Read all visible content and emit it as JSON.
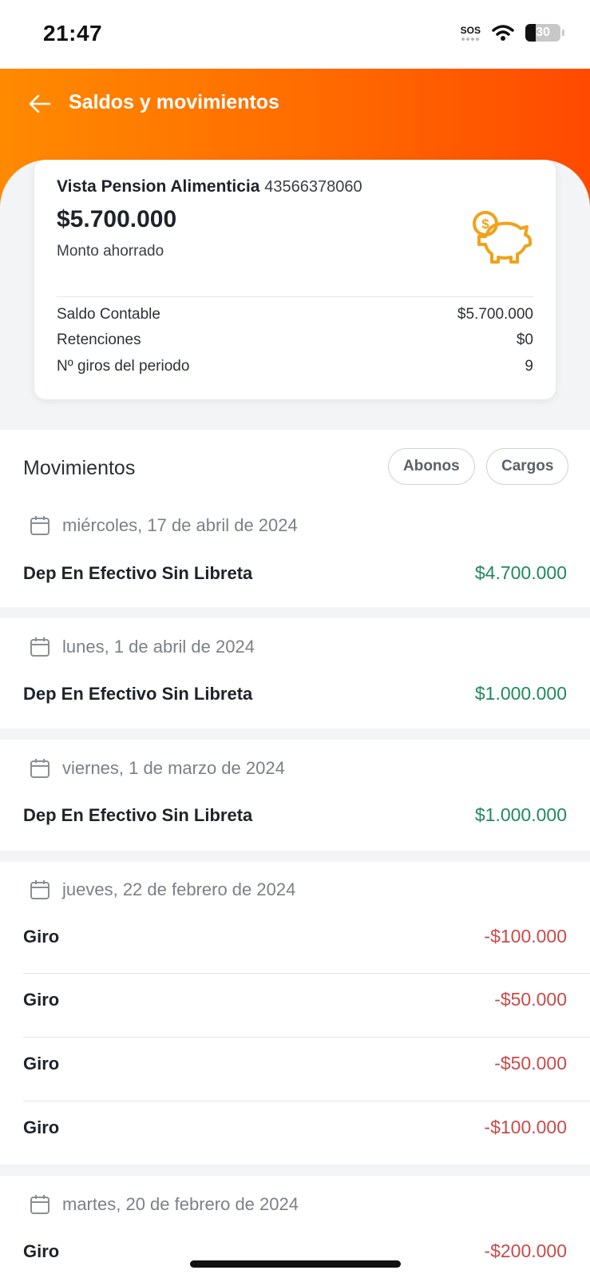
{
  "status_bar": {
    "time": "21:47",
    "sos": "SOS",
    "battery": "30"
  },
  "header": {
    "title": "Saldos y movimientos"
  },
  "account": {
    "name": "Vista Pension Alimenticia",
    "number": "43566378060",
    "amount": "$5.700.000",
    "amount_caption": "Monto ahorrado",
    "details": [
      {
        "label": "Saldo Contable",
        "value": "$5.700.000"
      },
      {
        "label": "Retenciones",
        "value": "$0"
      },
      {
        "label": "Nº giros del periodo",
        "value": "9"
      }
    ]
  },
  "movements": {
    "title": "Movimientos",
    "filters": [
      "Abonos",
      "Cargos"
    ],
    "groups": [
      {
        "date": "miércoles, 17 de abril de 2024",
        "items": [
          {
            "desc": "Dep En Efectivo Sin Libreta",
            "amount": "$4.700.000"
          }
        ]
      },
      {
        "date": "lunes, 1 de abril de 2024",
        "items": [
          {
            "desc": "Dep En Efectivo Sin Libreta",
            "amount": "$1.000.000"
          }
        ]
      },
      {
        "date": "viernes, 1 de marzo de 2024",
        "items": [
          {
            "desc": "Dep En Efectivo Sin Libreta",
            "amount": "$1.000.000"
          }
        ]
      },
      {
        "date": "jueves, 22 de febrero de 2024",
        "items": [
          {
            "desc": "Giro",
            "amount": "-$100.000"
          },
          {
            "desc": "Giro",
            "amount": "-$50.000"
          },
          {
            "desc": "Giro",
            "amount": "-$50.000"
          },
          {
            "desc": "Giro",
            "amount": "-$100.000"
          }
        ]
      },
      {
        "date": "martes, 20 de febrero de 2024",
        "items": [
          {
            "desc": "Giro",
            "amount": "-$200.000"
          }
        ]
      }
    ]
  },
  "colors": {
    "brand_orange": "#ff6a00",
    "positive": "#1f8a5c",
    "negative": "#c94a4a"
  },
  "icons": [
    "back-arrow-icon",
    "piggy-bank-icon",
    "calendar-icon",
    "wifi-icon",
    "battery-icon"
  ]
}
